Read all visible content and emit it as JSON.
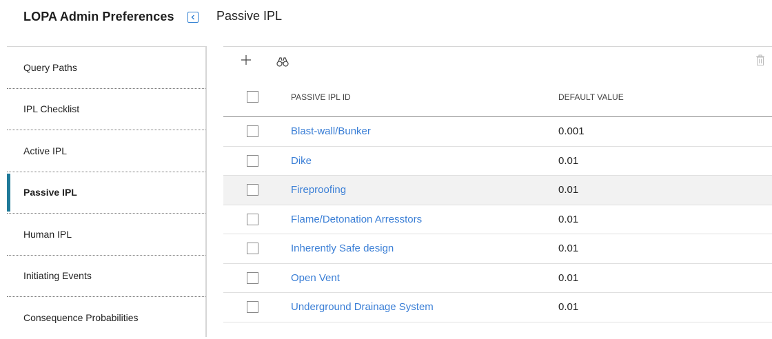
{
  "header": {
    "app_title": "LOPA Admin Preferences",
    "page_title": "Passive IPL",
    "collapse_icon": "chevron-left-icon"
  },
  "sidebar": {
    "active": "Passive IPL",
    "items": [
      {
        "label": "Query Paths"
      },
      {
        "label": "IPL Checklist"
      },
      {
        "label": "Active IPL"
      },
      {
        "label": "Passive IPL"
      },
      {
        "label": "Human IPL"
      },
      {
        "label": "Initiating Events"
      },
      {
        "label": "Consequence Probabilities"
      }
    ]
  },
  "toolbar": {
    "add_icon": "plus-icon",
    "find_icon": "binoculars-icon",
    "delete_icon": "trash-icon"
  },
  "grid": {
    "columns": [
      "PASSIVE IPL ID",
      "DEFAULT VALUE"
    ],
    "rows": [
      {
        "id": "Blast-wall/Bunker",
        "value": "0.001"
      },
      {
        "id": "Dike",
        "value": "0.01"
      },
      {
        "id": "Fireproofing",
        "value": "0.01"
      },
      {
        "id": "Flame/Detonation Arresstors",
        "value": "0.01"
      },
      {
        "id": "Inherently Safe design",
        "value": "0.01"
      },
      {
        "id": "Open Vent",
        "value": "0.01"
      },
      {
        "id": "Underground Drainage System",
        "value": "0.01"
      }
    ]
  },
  "colors": {
    "link": "#3b7fd6",
    "accent": "#1f7a99",
    "collapse_border": "#2f7fd1",
    "hover_row": "#f2f2f2"
  }
}
